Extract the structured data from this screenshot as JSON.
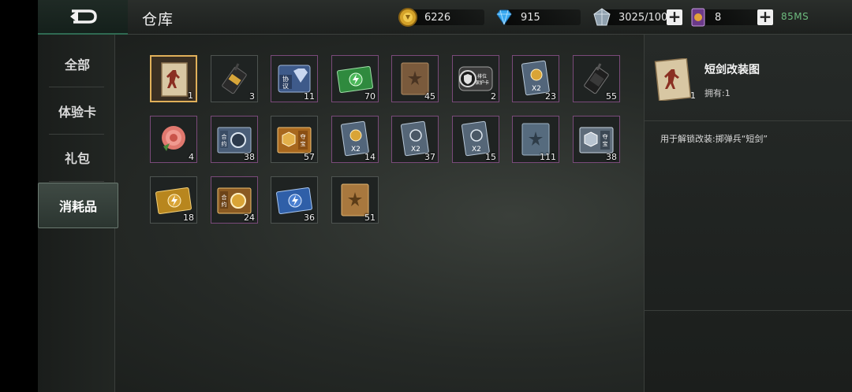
{
  "header": {
    "title": "仓库",
    "coins": "6226",
    "diamonds": "915",
    "crystals": "3025/100",
    "tickets": "8",
    "network": "85MS"
  },
  "categories": [
    {
      "label": "全部"
    },
    {
      "label": "体验卡"
    },
    {
      "label": "礼包"
    },
    {
      "label": "消耗品",
      "active": true
    }
  ],
  "items": [
    {
      "icon": "blueprint-card-icon",
      "count": "1"
    },
    {
      "icon": "walkie-talkie-gold-icon",
      "count": "3"
    },
    {
      "icon": "protocol-diamond-card-icon",
      "count": "11"
    },
    {
      "icon": "green-energy-ticket-icon",
      "count": "70"
    },
    {
      "icon": "brown-book-icon",
      "count": "45"
    },
    {
      "icon": "protection-card-icon",
      "count": "2"
    },
    {
      "icon": "double-coin-card-icon",
      "count": "23"
    },
    {
      "icon": "walkie-talkie-dark-icon",
      "count": "55"
    },
    {
      "icon": "rose-icon",
      "count": "4"
    },
    {
      "icon": "contract-ticket-blue-icon",
      "count": "38"
    },
    {
      "icon": "treasure-ticket-gold-icon",
      "count": "57"
    },
    {
      "icon": "double-coin-card-icon",
      "count": "14"
    },
    {
      "icon": "double-exp-card-icon",
      "count": "37"
    },
    {
      "icon": "double-exp-card-icon",
      "count": "15"
    },
    {
      "icon": "blue-book-icon",
      "count": "111"
    },
    {
      "icon": "treasure-ticket-silver-icon",
      "count": "38"
    },
    {
      "icon": "gold-energy-ticket-icon",
      "count": "18"
    },
    {
      "icon": "contract-ticket-gold-icon",
      "count": "24"
    },
    {
      "icon": "blue-energy-ticket-icon",
      "count": "36"
    },
    {
      "icon": "gold-book-icon",
      "count": "51"
    }
  ],
  "detail": {
    "name": "短剑改装图",
    "count": "1",
    "own": "拥有:1",
    "description": "用于解锁改装:掷弹兵“短剑”"
  }
}
